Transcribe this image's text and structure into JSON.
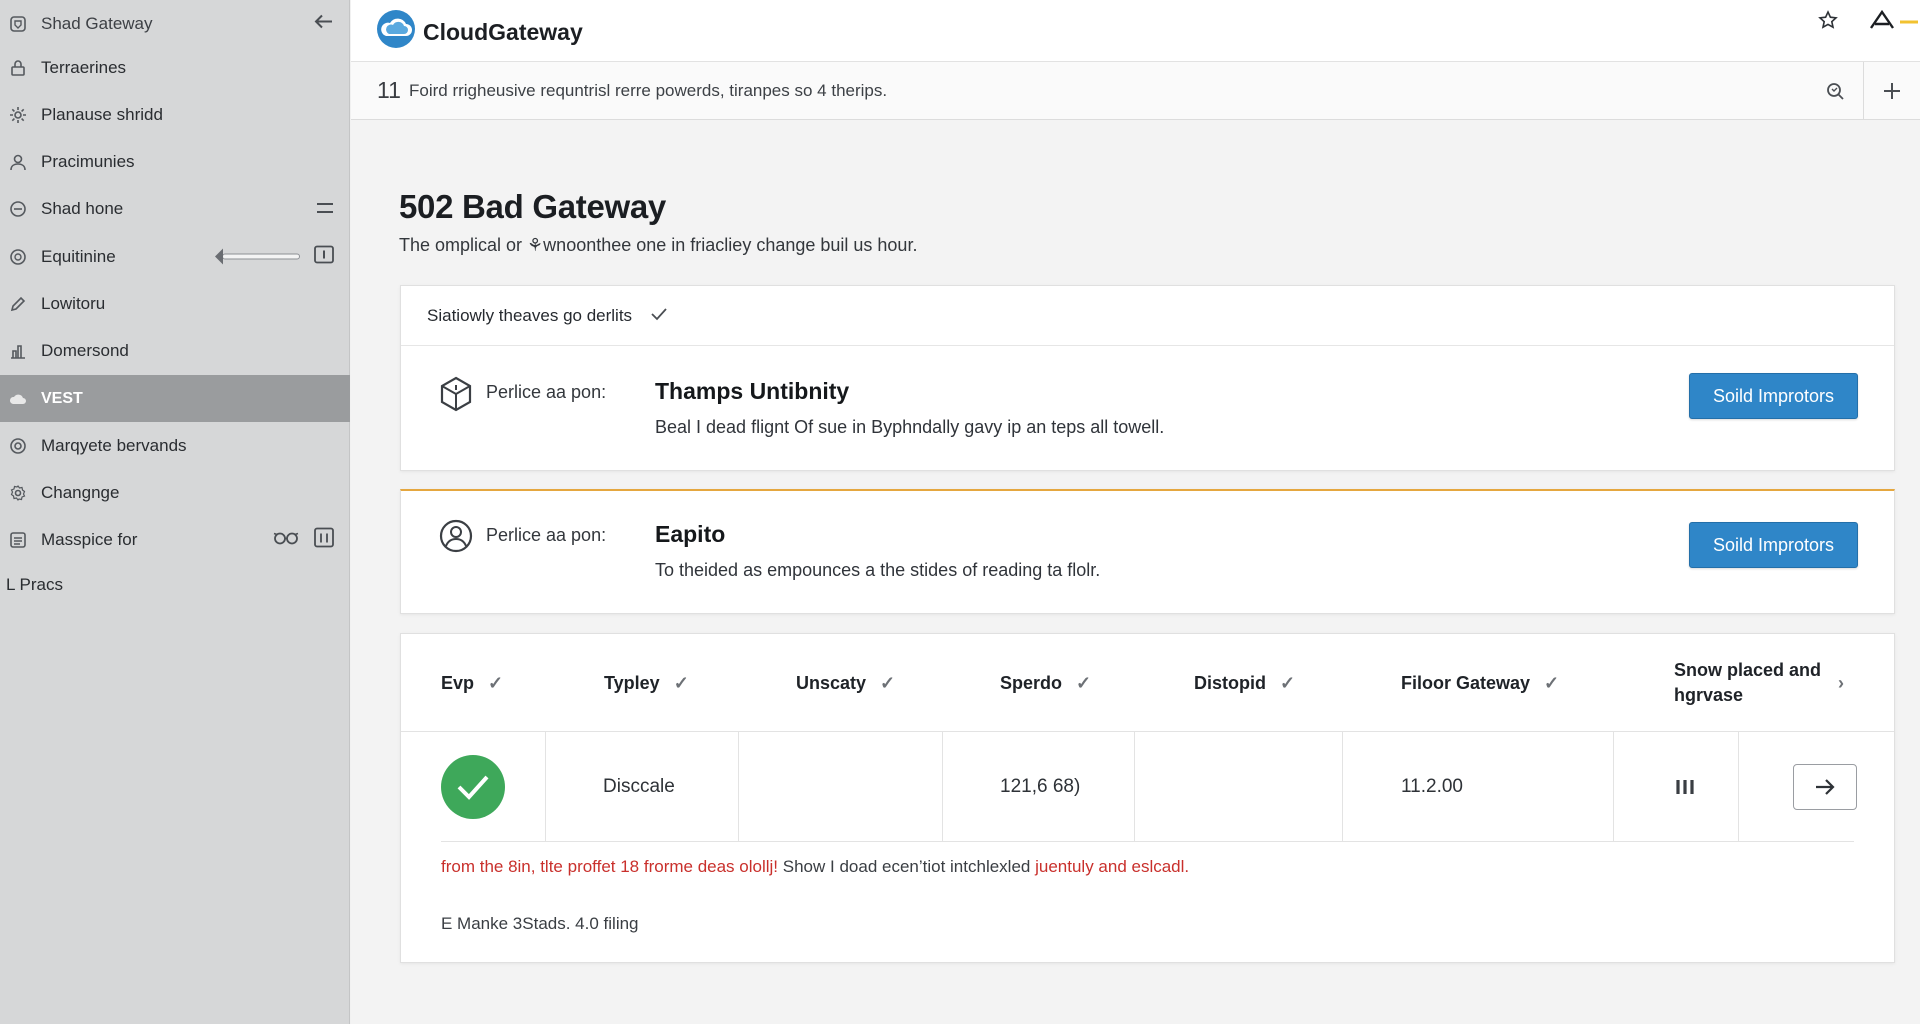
{
  "sidebar": {
    "items": [
      {
        "label": "Shad Gateway",
        "icon": "shield-icon"
      },
      {
        "label": "Terraerines",
        "icon": "lock-icon"
      },
      {
        "label": "Planause shridd",
        "icon": "gear-icon"
      },
      {
        "label": "Pracimunies",
        "icon": "user-icon"
      },
      {
        "label": "Shad hone",
        "icon": "clock-icon"
      },
      {
        "label": "Equitinine",
        "icon": "globe-icon"
      },
      {
        "label": "Lowitoru",
        "icon": "pencil-icon"
      },
      {
        "label": "Domersond",
        "icon": "people-icon"
      },
      {
        "label": "VEST",
        "icon": "cloud-icon"
      },
      {
        "label": "Marqyete bervands",
        "icon": "target-icon"
      },
      {
        "label": "Changnge",
        "icon": "settings-icon"
      },
      {
        "label": "Masspice for",
        "icon": "list-icon"
      }
    ],
    "plain_item": "L Pracs",
    "slider_fraction": 0.0
  },
  "topbar": {
    "brand": "CloudGateway"
  },
  "urlbar": {
    "number": "11",
    "text": "Foird rrigheusive requntrisl rerre powerds, tiranpes so 4 therips."
  },
  "main": {
    "title": "502 Bad Gateway",
    "subtitle": "The omplical or ⚘wnoonthee one in friacliey change buil us hour.",
    "status_text": "Siatiowly theaves go derlits",
    "problems": [
      {
        "label": "Perlice aa pon:",
        "title": "Thamps Untibnity",
        "description": "Beal I dead flignt Of sue in Byphndally gavy ip an teps all towell.",
        "button": "Soild Improtors",
        "icon": "cube-icon"
      },
      {
        "label": "Perlice aa pon:",
        "title": "Eapito",
        "description": "To theided as empounces a the stides of reading ta flolr.",
        "button": "Soild Improtors",
        "icon": "user-circle-icon"
      }
    ],
    "table": {
      "headers": [
        "Evp",
        "Typley",
        "Unscaty",
        "Sperdo",
        "Distopid",
        "Filoor Gateway",
        "Snow placed and\nhgrvase"
      ],
      "row": {
        "status": "ok",
        "c1": "Disccale",
        "c2": "",
        "c3": "121,6 68)",
        "c4": "",
        "c5": "11.2.00"
      },
      "error_red_1": "from the 8in, tlte proffet 18 frorme deas olollj!",
      "error_mid": " Show I doad ecen’tiot intchlexled ",
      "error_red_2": "juentuly and eslcadl.",
      "footer": "E Manke 3Stads. 4.0 filing"
    }
  },
  "colors": {
    "accent_blue": "#2f86c8",
    "success_green": "#3ea85a",
    "warning_orange": "#e5a73f",
    "error_red": "#c9302c",
    "sidebar_active": "#9a9c9e"
  }
}
